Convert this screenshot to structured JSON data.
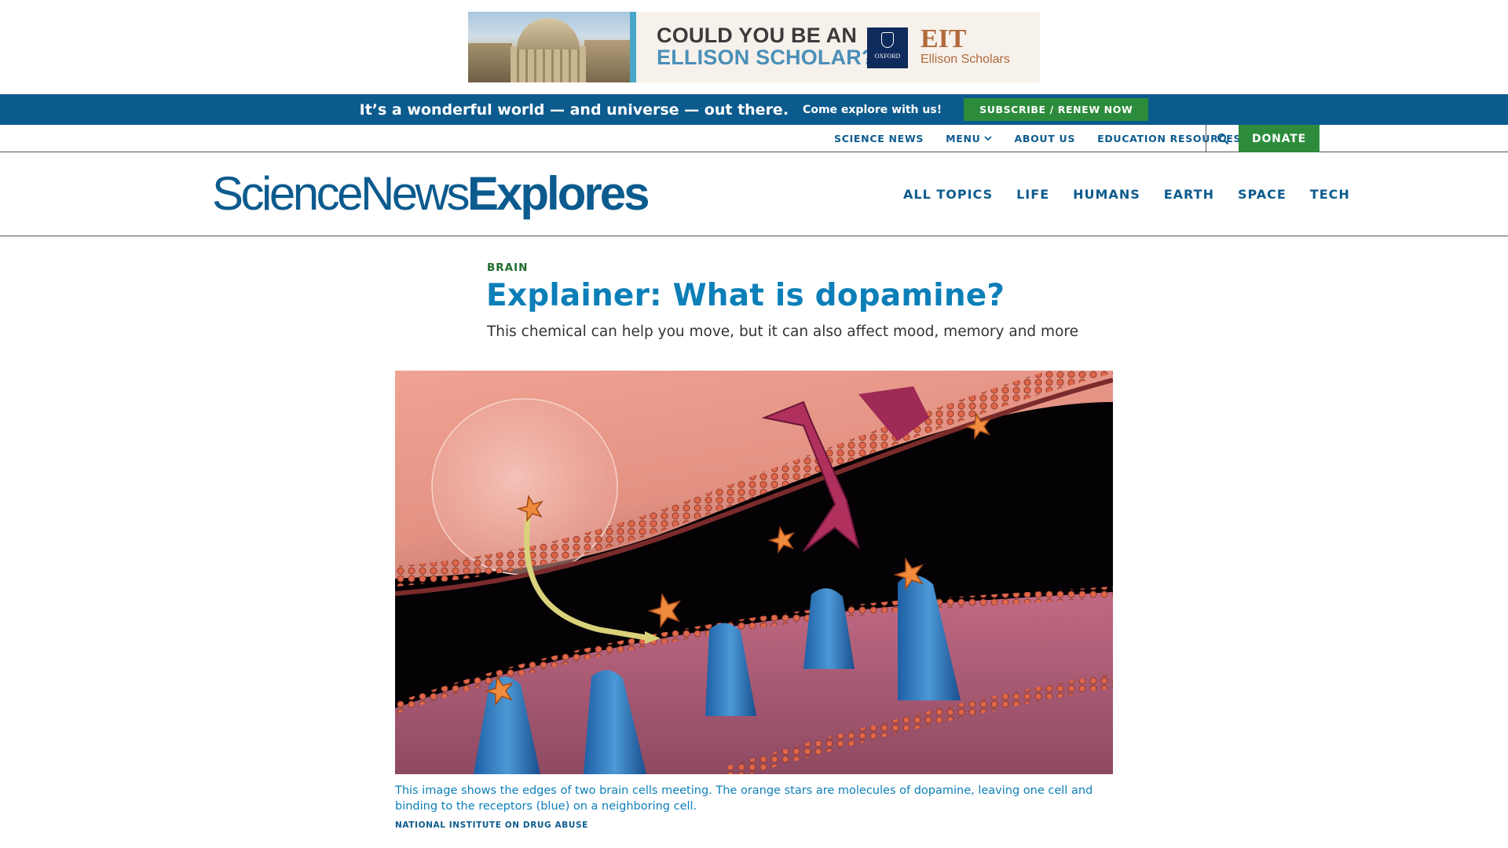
{
  "ad": {
    "line1": "COULD YOU BE AN",
    "line2": "ELLISON SCHOLAR?",
    "logo_text": "OXFORD",
    "brand": "EIT",
    "brand_sub": "Ellison Scholars"
  },
  "promo": {
    "headline": "It’s a wonderful world — and universe — out there.",
    "tagline": "Come explore with us!",
    "subscribe_label": "SUBSCRIBE / RENEW NOW"
  },
  "utility_nav": {
    "items": [
      "SCIENCE NEWS",
      "MENU",
      "ABOUT US",
      "EDUCATION RESOURCES"
    ],
    "donate_label": "DONATE",
    "search_icon": "search-icon"
  },
  "header": {
    "logo_part1": "ScienceNews",
    "logo_part2": "Explores",
    "topics": [
      "ALL TOPICS",
      "LIFE",
      "HUMANS",
      "EARTH",
      "SPACE",
      "TECH"
    ]
  },
  "article": {
    "kicker": "BRAIN",
    "title": "Explainer: What is dopamine?",
    "dek": "This chemical can help you move, but it can also affect mood, memory and more",
    "caption": "This image shows the edges of two brain cells meeting. The orange stars are molecules of dopamine, leaving one cell and binding to the receptors (blue) on a neighboring cell.",
    "credit": "NATIONAL INSTITUTE ON DRUG ABUSE"
  },
  "colors": {
    "brand_blue": "#0c5b8e",
    "title_blue": "#0c7fb8",
    "green": "#2c8c3c"
  }
}
